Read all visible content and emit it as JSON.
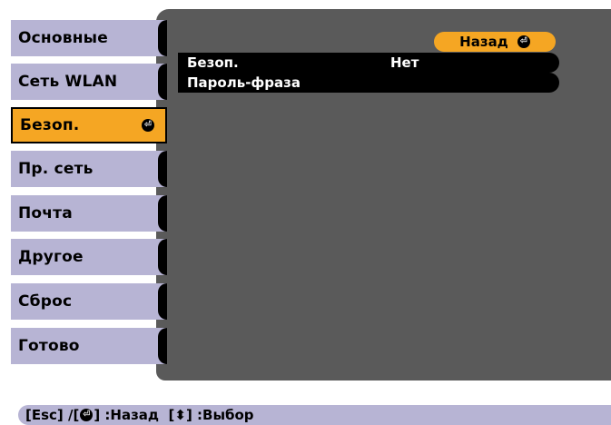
{
  "menu": {
    "items": [
      {
        "label": "Основные",
        "active": false
      },
      {
        "label": "Сеть WLAN",
        "active": false
      },
      {
        "label": "Безоп.",
        "active": true
      },
      {
        "label": "Пр. сеть",
        "active": false
      },
      {
        "label": "Почта",
        "active": false
      },
      {
        "label": "Другое",
        "active": false
      },
      {
        "label": "Сброс",
        "active": false
      },
      {
        "label": "Готово",
        "active": false
      }
    ]
  },
  "panel": {
    "back_label": "Назад",
    "rows": [
      {
        "label": "Безоп.",
        "value": "Нет"
      },
      {
        "label": "Пароль-фраза",
        "value": ""
      }
    ]
  },
  "help": {
    "part1": "[Esc] /[",
    "part2": "] :Назад  [",
    "updown_glyph": "⬍",
    "part3": "] :Выбор"
  },
  "colors": {
    "menu_bg": "#b7b4d4",
    "active_bg": "#f5a623",
    "panel_bg": "#5a5a5a",
    "row_bg": "#000000"
  }
}
